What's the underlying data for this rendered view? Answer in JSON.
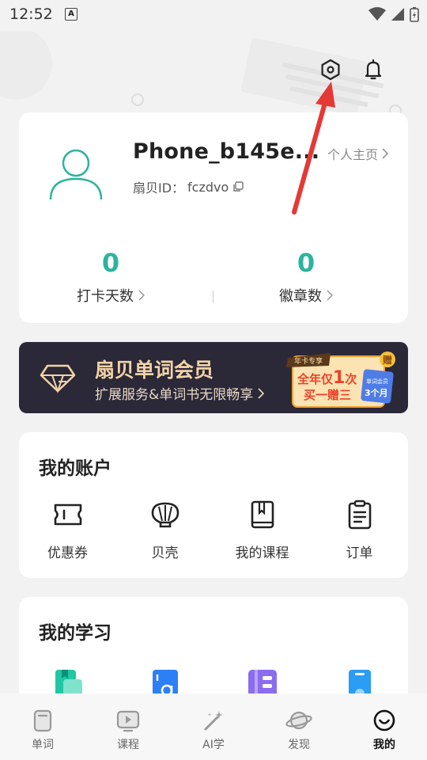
{
  "status": {
    "time": "12:52",
    "notif_glyph": "A"
  },
  "header": {
    "settings_icon": "settings-hexagon-icon",
    "bell_icon": "bell-icon"
  },
  "profile": {
    "username": "Phone_b145e...",
    "id_label": "扇贝ID：",
    "id_value": "fczdvo",
    "homepage_link": "个人主页",
    "stats": [
      {
        "value": "0",
        "label": "打卡天数"
      },
      {
        "value": "0",
        "label": "徽章数"
      }
    ]
  },
  "vip": {
    "title": "扇贝单词会员",
    "subtitle": "扩展服务&单词书无限畅享",
    "promo": {
      "tag": "年卡专享",
      "line1_pre": "全年仅",
      "line1_num": "1",
      "line1_post": "次",
      "line2": "买一赠三",
      "corner": "赠",
      "ticket_small": "单词会员",
      "ticket_big": "3个月"
    }
  },
  "account": {
    "title": "我的账户",
    "items": [
      {
        "label": "优惠券",
        "icon": "coupon-icon"
      },
      {
        "label": "贝壳",
        "icon": "shell-icon"
      },
      {
        "label": "我的课程",
        "icon": "course-book-icon"
      },
      {
        "label": "订单",
        "icon": "order-clipboard-icon"
      }
    ]
  },
  "study": {
    "title": "我的学习",
    "items": [
      {
        "icon": "bookmark-book-icon"
      },
      {
        "icon": "word-card-icon"
      },
      {
        "icon": "notebook-icon"
      },
      {
        "icon": "phone-lock-icon"
      }
    ]
  },
  "tabs": [
    {
      "label": "单词",
      "icon": "word-tab-icon",
      "active": false
    },
    {
      "label": "课程",
      "icon": "play-tab-icon",
      "active": false
    },
    {
      "label": "AI学",
      "icon": "magic-wand-icon",
      "active": false
    },
    {
      "label": "发现",
      "icon": "planet-icon",
      "active": false
    },
    {
      "label": "我的",
      "icon": "smile-face-icon",
      "active": true
    }
  ],
  "colors": {
    "accent_teal": "#2db39e",
    "vip_bg": "#2b2838",
    "vip_gold": "#f2d3a6",
    "promo_orange": "#f4a23a",
    "promo_red": "#e8432b",
    "arrow_red": "#e53935",
    "study_teal": "#1fc7a4",
    "study_blue": "#2d7ff5",
    "study_purple": "#8b6cf0",
    "study_lightblue": "#2a9df4"
  }
}
